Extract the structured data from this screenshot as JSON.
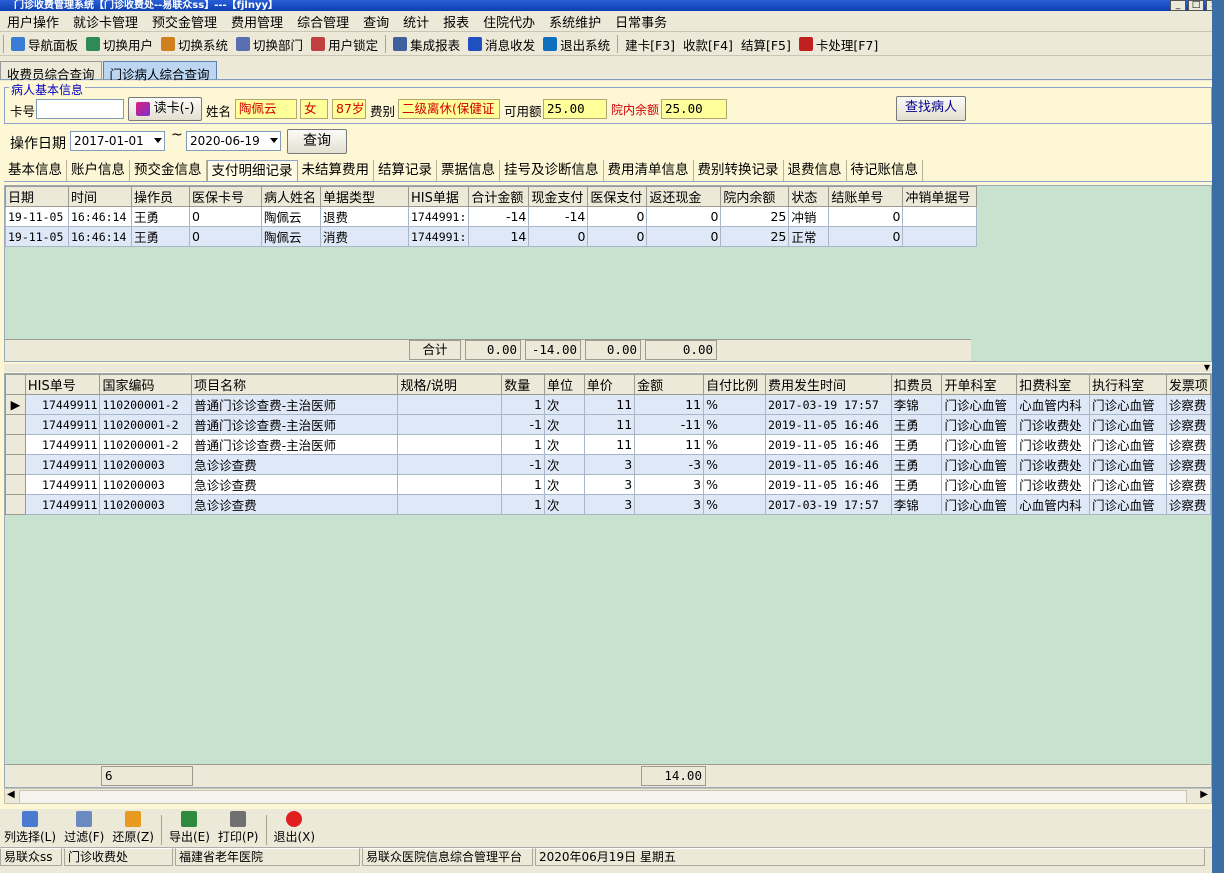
{
  "window": {
    "title": "门诊收费管理系统【门诊收费处--易联众ss】---【fjlnyy】"
  },
  "menu": [
    "用户操作",
    "就诊卡管理",
    "预交金管理",
    "费用管理",
    "综合管理",
    "查询",
    "统计",
    "报表",
    "住院代办",
    "系统维护",
    "日常事务"
  ],
  "toolbar": [
    {
      "label": "导航面板",
      "icon": "navigation-panel-icon"
    },
    {
      "label": "切换用户",
      "icon": "switch-user-icon"
    },
    {
      "label": "切换系统",
      "icon": "switch-system-icon"
    },
    {
      "label": "切换部门",
      "icon": "switch-department-icon"
    },
    {
      "label": "用户锁定",
      "icon": "user-lock-icon"
    },
    {
      "label": "集成报表",
      "icon": "integrated-report-icon"
    },
    {
      "label": "消息收发",
      "icon": "message-icon"
    },
    {
      "label": "退出系统",
      "icon": "exit-system-icon"
    },
    {
      "label": "建卡[F3]"
    },
    {
      "label": "收款[F4]"
    },
    {
      "label": "结算[F5]"
    },
    {
      "label": "卡处理[F7]",
      "icon": "card-process-icon"
    }
  ],
  "top_tabs": [
    "收费员综合查询",
    "门诊病人综合查询"
  ],
  "patient": {
    "group_title": "病人基本信息",
    "card_label": "卡号",
    "card_value": "",
    "read_card_label": "读卡(-)",
    "name_label": "姓名",
    "name": "陶佩云",
    "gender": "女",
    "age": "87岁",
    "fee_type_label": "费别",
    "fee_type": "二级离休(保健证",
    "available_label": "可用额",
    "available": "25.00",
    "balance_label": "院内余额",
    "balance": "25.00",
    "find_button": "查找病人"
  },
  "date_filter": {
    "label": "操作日期",
    "start": "2017-01-01",
    "sep": "~",
    "end": "2020-06-19",
    "query_button": "查询"
  },
  "sub_tabs": [
    "基本信息",
    "账户信息",
    "预交金信息",
    "支付明细记录",
    "未结算费用",
    "结算记录",
    "票据信息",
    "挂号及诊断信息",
    "费用清单信息",
    "费别转换记录",
    "退费信息",
    "待记账信息"
  ],
  "payments": {
    "headers": [
      "日期",
      "时间",
      "操作员",
      "医保卡号",
      "病人姓名",
      "单据类型",
      "HIS单据",
      "合计金额",
      "现金支付",
      "医保支付",
      "返还现金",
      "院内余额",
      "状态",
      "结账单号",
      "冲销单据号"
    ],
    "rows": [
      [
        "19-11-05",
        "16:46:14",
        "王勇",
        "0",
        "陶佩云",
        "退费",
        "1744991:",
        "-14",
        "-14",
        "0",
        "0",
        "25",
        "冲销",
        "0",
        ""
      ],
      [
        "19-11-05",
        "16:46:14",
        "王勇",
        "0",
        "陶佩云",
        "消费",
        "1744991:",
        "14",
        "0",
        "0",
        "0",
        "25",
        "正常",
        "0",
        ""
      ]
    ],
    "summary_label": "合计",
    "summary": [
      "0.00",
      "-14.00",
      "0.00",
      "0.00"
    ]
  },
  "details": {
    "headers": [
      "HIS单号",
      "国家编码",
      "项目名称",
      "规格/说明",
      "数量",
      "单位",
      "单价",
      "金额",
      "自付比例",
      "费用发生时间",
      "扣费员",
      "开单科室",
      "扣费科室",
      "执行科室",
      "发票项"
    ],
    "rows": [
      [
        "17449911",
        "110200001-2",
        "普通门诊诊查费-主治医师",
        "",
        "1",
        "次",
        "11",
        "11",
        "%",
        "2017-03-19 17:57",
        "李锦",
        "门诊心血管",
        "心血管内科",
        "门诊心血管",
        "诊察费"
      ],
      [
        "17449911",
        "110200001-2",
        "普通门诊诊查费-主治医师",
        "",
        "-1",
        "次",
        "11",
        "-11",
        "%",
        "2019-11-05 16:46",
        "王勇",
        "门诊心血管",
        "门诊收费处",
        "门诊心血管",
        "诊察费"
      ],
      [
        "17449911",
        "110200001-2",
        "普通门诊诊查费-主治医师",
        "",
        "1",
        "次",
        "11",
        "11",
        "%",
        "2019-11-05 16:46",
        "王勇",
        "门诊心血管",
        "门诊收费处",
        "门诊心血管",
        "诊察费"
      ],
      [
        "17449911",
        "110200003",
        "急诊诊查费",
        "",
        "-1",
        "次",
        "3",
        "-3",
        "%",
        "2019-11-05 16:46",
        "王勇",
        "门诊心血管",
        "门诊收费处",
        "门诊心血管",
        "诊察费"
      ],
      [
        "17449911",
        "110200003",
        "急诊诊查费",
        "",
        "1",
        "次",
        "3",
        "3",
        "%",
        "2019-11-05 16:46",
        "王勇",
        "门诊心血管",
        "门诊收费处",
        "门诊心血管",
        "诊察费"
      ],
      [
        "17449911",
        "110200003",
        "急诊诊查费",
        "",
        "1",
        "次",
        "3",
        "3",
        "%",
        "2017-03-19 17:57",
        "李锦",
        "门诊心血管",
        "心血管内科",
        "门诊心血管",
        "诊察费"
      ]
    ],
    "count": "6",
    "total": "14.00"
  },
  "bottom_buttons": [
    {
      "label": "列选择(L)",
      "icon": "column-select-icon"
    },
    {
      "label": "过滤(F)",
      "icon": "filter-icon"
    },
    {
      "label": "还原(Z)",
      "icon": "restore-icon"
    },
    {
      "label": "导出(E)",
      "icon": "export-excel-icon"
    },
    {
      "label": "打印(P)",
      "icon": "print-icon"
    },
    {
      "label": "退出(X)",
      "icon": "power-exit-icon"
    }
  ],
  "status": [
    "易联众ss",
    "门诊收费处",
    "福建省老年医院",
    "易联众医院信息综合管理平台",
    "2020年06月19日 星期五"
  ]
}
